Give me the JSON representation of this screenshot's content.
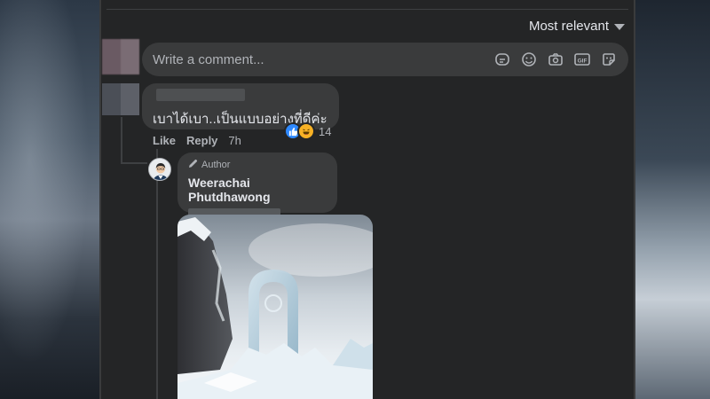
{
  "sort": {
    "label": "Most relevant"
  },
  "composer": {
    "placeholder": "Write a comment...",
    "icons": [
      "sticker-icon",
      "emoji-icon",
      "camera-icon",
      "gif-icon",
      "avatar-sticker-icon"
    ]
  },
  "comment1": {
    "text": "เบาได้เบา..เป็นแบบอย่างที่ดีค่ะ",
    "reaction_count": "14",
    "reactions": [
      "like",
      "haha"
    ],
    "actions": {
      "like": "Like",
      "reply": "Reply",
      "time": "7h"
    }
  },
  "reply1": {
    "badge": "Author",
    "name": "Weerachai Phutdhawong"
  },
  "colors": {
    "panel": "#242526",
    "bubble": "#3a3b3c",
    "text": "#e4e6eb",
    "muted": "#b0b3b8",
    "like_blue": "#2e89ff",
    "haha_yellow": "#f7b125"
  }
}
